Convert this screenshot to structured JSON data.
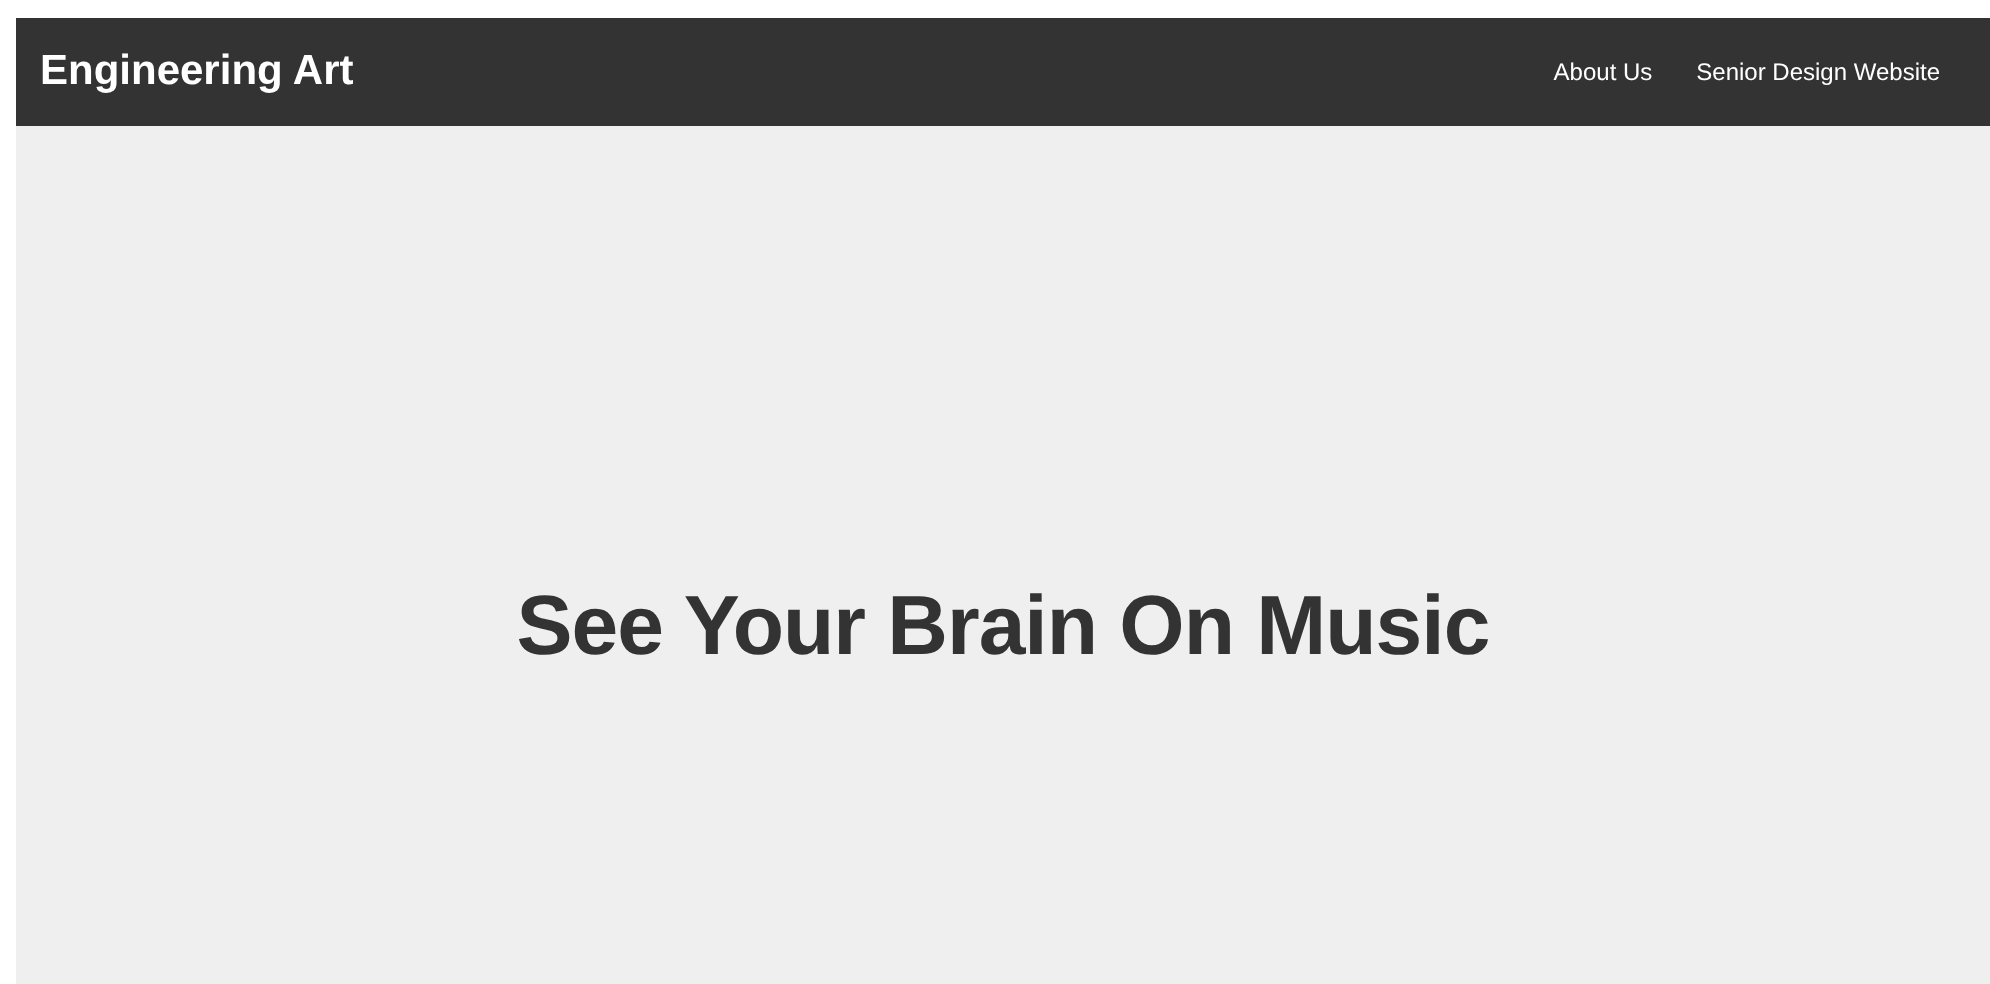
{
  "navbar": {
    "brand": "Engineering Art",
    "links": [
      {
        "label": "About Us"
      },
      {
        "label": "Senior Design Website"
      }
    ]
  },
  "hero": {
    "heading": "See Your Brain On Music"
  }
}
